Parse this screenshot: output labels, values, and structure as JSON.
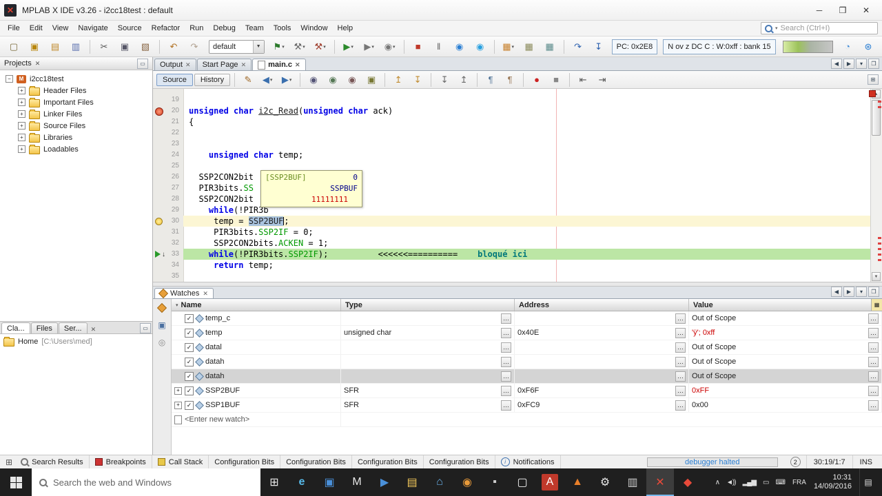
{
  "window": {
    "title": "MPLAB X IDE v3.26 - i2cc18test : default"
  },
  "menu": {
    "items": [
      "File",
      "Edit",
      "View",
      "Navigate",
      "Source",
      "Refactor",
      "Run",
      "Debug",
      "Team",
      "Tools",
      "Window",
      "Help"
    ],
    "search_placeholder": "Search (Ctrl+I)"
  },
  "toolbar": {
    "config_value": "default",
    "pc_label": "PC: 0x2E8",
    "flags_label": "N ov z DC C : W:0xff : bank 15",
    "icons_a": [
      {
        "name": "new-file",
        "glyph": "▢",
        "color": "#7a6a3a"
      },
      {
        "name": "new-project",
        "glyph": "▣",
        "color": "#b8860b"
      },
      {
        "name": "open-project",
        "glyph": "▤",
        "color": "#c08a2d"
      },
      {
        "name": "save-all",
        "glyph": "▥",
        "color": "#5a6fae"
      },
      {
        "sep": true
      },
      {
        "name": "cut",
        "glyph": "✂",
        "color": "#555555"
      },
      {
        "name": "copy",
        "glyph": "▣",
        "color": "#555566"
      },
      {
        "name": "paste",
        "glyph": "▧",
        "color": "#886644"
      },
      {
        "sep": true
      },
      {
        "name": "undo",
        "glyph": "↶",
        "color": "#b07020"
      },
      {
        "name": "redo",
        "glyph": "↷",
        "color": "#b0a090"
      }
    ],
    "icons_b": [
      {
        "name": "set-project-configuration",
        "glyph": "⚑",
        "color": "#2c7a2c",
        "dd": true
      },
      {
        "name": "build-project",
        "glyph": "⚒",
        "color": "#666666",
        "dd": true
      },
      {
        "name": "clean-build-project",
        "glyph": "⚒",
        "color": "#a04030",
        "dd": true
      },
      {
        "sep": true
      },
      {
        "name": "run-project",
        "glyph": "▶",
        "color": "#2c8a2c",
        "dd": true
      },
      {
        "name": "debug-project",
        "glyph": "▶",
        "color": "#777777",
        "dd": true
      },
      {
        "name": "profile-project",
        "glyph": "◉",
        "color": "#777777",
        "dd": true
      },
      {
        "sep": true
      },
      {
        "name": "finish-debugger-session",
        "glyph": "■",
        "color": "#c03a2b"
      },
      {
        "name": "pause-debugger",
        "glyph": "‖",
        "color": "#666666"
      },
      {
        "name": "reset-device",
        "glyph": "◉",
        "color": "#2a7fd4"
      },
      {
        "name": "continue-debugger",
        "glyph": "◉",
        "color": "#27a0e0"
      },
      {
        "sep": true
      },
      {
        "name": "make-and-program-device",
        "glyph": "▦",
        "color": "#c77f2a",
        "dd": true
      },
      {
        "name": "read-device-memory",
        "glyph": "▦",
        "color": "#8a8a5a"
      },
      {
        "name": "hold-in-reset",
        "glyph": "▦",
        "color": "#5a8a8a"
      },
      {
        "sep": true
      },
      {
        "name": "step-over",
        "glyph": "↷",
        "color": "#2a5fae"
      },
      {
        "name": "step-into",
        "glyph": "↧",
        "color": "#2a5fae"
      }
    ]
  },
  "projects": {
    "title": "Projects",
    "root": "i2cc18test",
    "items": [
      "Header Files",
      "Important Files",
      "Linker Files",
      "Source Files",
      "Libraries",
      "Loadables"
    ]
  },
  "explorer": {
    "tabs": [
      "Cla...",
      "Files",
      "Ser..."
    ],
    "home_label": "Home",
    "home_path": "[C:\\Users\\med]"
  },
  "editor": {
    "tabs": [
      {
        "label": "Output"
      },
      {
        "label": "Start Page"
      },
      {
        "label": "main.c",
        "active": true
      }
    ],
    "views": [
      "Source",
      "History"
    ],
    "toolbar_icons": [
      {
        "name": "last-edit-location",
        "glyph": "✎",
        "color": "#a06a2a"
      },
      {
        "name": "back",
        "glyph": "◀",
        "color": "#3a6fae",
        "dd": true
      },
      {
        "name": "forward",
        "glyph": "▶",
        "color": "#3a6fae",
        "dd": true
      },
      {
        "sep": true
      },
      {
        "name": "find-selection",
        "glyph": "◉",
        "color": "#555577"
      },
      {
        "name": "find-next-occurrence",
        "glyph": "◉",
        "color": "#557755"
      },
      {
        "name": "find-previous-occurrence",
        "glyph": "◉",
        "color": "#775555"
      },
      {
        "name": "toggle-highlight-search",
        "glyph": "▣",
        "color": "#777733"
      },
      {
        "sep": true
      },
      {
        "name": "previous-bookmark",
        "glyph": "↥",
        "color": "#c08a2d"
      },
      {
        "name": "next-bookmark",
        "glyph": "↧",
        "color": "#c08a2d"
      },
      {
        "sep": true
      },
      {
        "name": "next-usage",
        "glyph": "↧",
        "color": "#666666"
      },
      {
        "name": "previous-usage",
        "glyph": "↥",
        "color": "#666666"
      },
      {
        "sep": true
      },
      {
        "name": "comment",
        "glyph": "¶",
        "color": "#557799"
      },
      {
        "name": "uncomment",
        "glyph": "¶",
        "color": "#997755"
      },
      {
        "sep": true
      },
      {
        "name": "start-macro-recording",
        "glyph": "●",
        "color": "#cc2222"
      },
      {
        "name": "stop-macro-recording",
        "glyph": "■",
        "color": "#888888"
      },
      {
        "sep": true
      },
      {
        "name": "shift-line-left",
        "glyph": "⇤",
        "color": "#555555"
      },
      {
        "name": "shift-line-right",
        "glyph": "⇥",
        "color": "#555555"
      }
    ],
    "tooltip": {
      "name": "[SSP2BUF]",
      "value": "0",
      "register": "SSPBUF",
      "bits": "11111111"
    },
    "lines": [
      {
        "num": 19,
        "segs": []
      },
      {
        "num": 20,
        "gutter": "breakpoint",
        "segs": [
          {
            "t": "unsigned char",
            "c": "kw"
          },
          {
            "t": " ",
            "c": "pl"
          },
          {
            "t": "i2c_Read",
            "c": "fn"
          },
          {
            "t": "(",
            "c": "pl"
          },
          {
            "t": "unsigned char",
            "c": "kw"
          },
          {
            "t": " ack)",
            "c": "pl"
          }
        ]
      },
      {
        "num": 21,
        "segs": [
          {
            "t": "{",
            "c": "pl"
          }
        ]
      },
      {
        "num": 22,
        "segs": []
      },
      {
        "num": 23,
        "segs": []
      },
      {
        "num": 24,
        "segs": [
          {
            "t": "    ",
            "c": "pl"
          },
          {
            "t": "unsigned char",
            "c": "kw"
          },
          {
            "t": " temp;",
            "c": "pl"
          }
        ]
      },
      {
        "num": 25,
        "segs": []
      },
      {
        "num": 26,
        "segs": [
          {
            "t": "  SSP2CON2bit",
            "c": "pl"
          }
        ]
      },
      {
        "num": 27,
        "segs": [
          {
            "t": "  PIR3bits.",
            "c": "pl"
          },
          {
            "t": "SS",
            "c": "mem"
          }
        ]
      },
      {
        "num": 28,
        "segs": [
          {
            "t": "  SSP2CON2bit",
            "c": "pl"
          }
        ]
      },
      {
        "num": 29,
        "segs": [
          {
            "t": "    ",
            "c": "pl"
          },
          {
            "t": "while",
            "c": "kw"
          },
          {
            "t": "(!PIR3b",
            "c": "pl"
          }
        ]
      },
      {
        "num": 30,
        "hl": "current",
        "gutter": "bulb",
        "segs": [
          {
            "t": "     temp = ",
            "c": "pl"
          },
          {
            "t": "SSP2BUF",
            "c": "sel"
          },
          {
            "t": "",
            "c": "caret"
          },
          {
            "t": ";",
            "c": "pl"
          }
        ]
      },
      {
        "num": 31,
        "segs": [
          {
            "t": "     PIR3bits.",
            "c": "pl"
          },
          {
            "t": "SSP2IF",
            "c": "mem"
          },
          {
            "t": " = 0;",
            "c": "pl"
          }
        ]
      },
      {
        "num": 32,
        "segs": [
          {
            "t": "     SSP2CON2bits.",
            "c": "pl"
          },
          {
            "t": "ACKEN",
            "c": "mem"
          },
          {
            "t": " = 1;",
            "c": "pl"
          }
        ]
      },
      {
        "num": 33,
        "hl": "debug",
        "gutter": "pc",
        "segs": [
          {
            "t": "    ",
            "c": "pl"
          },
          {
            "t": "while",
            "c": "kw"
          },
          {
            "t": "(!PIR3bits.",
            "c": "pl"
          },
          {
            "t": "SSP2IF",
            "c": "mem"
          },
          {
            "t": ");",
            "c": "pl"
          },
          {
            "t": "          <<<<<<==========    ",
            "c": "pl"
          },
          {
            "t": "bloqué ici",
            "c": "note"
          }
        ]
      },
      {
        "num": 34,
        "segs": [
          {
            "t": "     ",
            "c": "pl"
          },
          {
            "t": "return",
            "c": "kw"
          },
          {
            "t": " temp;",
            "c": "pl"
          }
        ]
      },
      {
        "num": 35,
        "segs": []
      }
    ]
  },
  "watches": {
    "tab_label": "Watches",
    "columns": [
      "Name",
      "Type",
      "Address",
      "Value"
    ],
    "rows": [
      {
        "name": "temp_c",
        "type": "",
        "address": "",
        "value": "Out of Scope"
      },
      {
        "name": "temp",
        "type": "unsigned char",
        "address": "0x40E",
        "value": "'ÿ'; 0xff",
        "red": true
      },
      {
        "name": "datal",
        "type": "",
        "address": "",
        "value": "Out of Scope"
      },
      {
        "name": "datah",
        "type": "",
        "address": "",
        "value": "Out of Scope"
      },
      {
        "name": "datah",
        "type": "",
        "address": "",
        "value": "Out of Scope",
        "selected": true
      },
      {
        "name": "SSP2BUF",
        "type": "SFR",
        "address": "0xF6F",
        "value": "0xFF",
        "red": true,
        "expandable": true
      },
      {
        "name": "SSP1BUF",
        "type": "SFR",
        "address": "0xFC9",
        "value": "0x00",
        "expandable": true
      }
    ],
    "new_watch_label": "<Enter new watch>"
  },
  "statusbar": {
    "items": [
      {
        "icon": "search",
        "label": "Search Results"
      },
      {
        "icon": "breakpoint",
        "label": "Breakpoints"
      },
      {
        "icon": "callstack",
        "label": "Call Stack"
      },
      {
        "label": "Configuration Bits"
      },
      {
        "label": "Configuration Bits"
      },
      {
        "label": "Configuration Bits"
      },
      {
        "label": "Configuration Bits"
      },
      {
        "icon": "info",
        "label": "Notifications"
      }
    ],
    "debug_status": "debugger halted",
    "badge": "2",
    "caret_position": "30:19/1:7",
    "insert_mode": "INS"
  },
  "taskbar": {
    "search_placeholder": "Search the web and Windows",
    "icons": [
      {
        "name": "task-view",
        "glyph": "⊞",
        "fg": "#e8e8e8"
      },
      {
        "name": "edge-browser",
        "glyph": "e",
        "fg": "#57b9e8",
        "bold": true
      },
      {
        "name": "photos-app",
        "glyph": "▣",
        "fg": "#4a90d9"
      },
      {
        "name": "mail-app",
        "glyph": "M",
        "fg": "#e8e8e8"
      },
      {
        "name": "movies-app",
        "glyph": "▶",
        "fg": "#4a90d9"
      },
      {
        "name": "file-explorer",
        "glyph": "▤",
        "fg": "#f0c75a"
      },
      {
        "name": "store-app",
        "glyph": "⌂",
        "fg": "#6ab0e8"
      },
      {
        "name": "photos2-app",
        "glyph": "◉",
        "fg": "#e89a3a"
      },
      {
        "name": "command-app",
        "glyph": "▪",
        "fg": "#cccccc"
      },
      {
        "name": "notepad-app",
        "glyph": "▢",
        "fg": "#f0f0f0"
      },
      {
        "name": "adobe-reader",
        "glyph": "A",
        "fg": "#ffffff",
        "bg": "#c0392b"
      },
      {
        "name": "vlc-player",
        "glyph": "▲",
        "fg": "#e87f2a"
      },
      {
        "name": "settings-app",
        "glyph": "⚙",
        "fg": "#e8e8e8"
      },
      {
        "name": "printer-app",
        "glyph": "▥",
        "fg": "#cccccc"
      },
      {
        "name": "mplab-x-ide",
        "glyph": "✕",
        "fg": "#e84a3a",
        "active": true
      },
      {
        "name": "amd-app",
        "glyph": "◆",
        "fg": "#e84a3a"
      }
    ],
    "tray": [
      {
        "name": "hidden-icons-chevron",
        "glyph": "∧"
      },
      {
        "name": "volume",
        "glyph": "◄))"
      },
      {
        "name": "network",
        "glyph": "▂▄▆"
      },
      {
        "name": "display",
        "glyph": "▭"
      },
      {
        "name": "touch-keyboard",
        "glyph": "⌨"
      }
    ],
    "language": "FRA",
    "time": "10:31",
    "date": "14/09/2016"
  }
}
